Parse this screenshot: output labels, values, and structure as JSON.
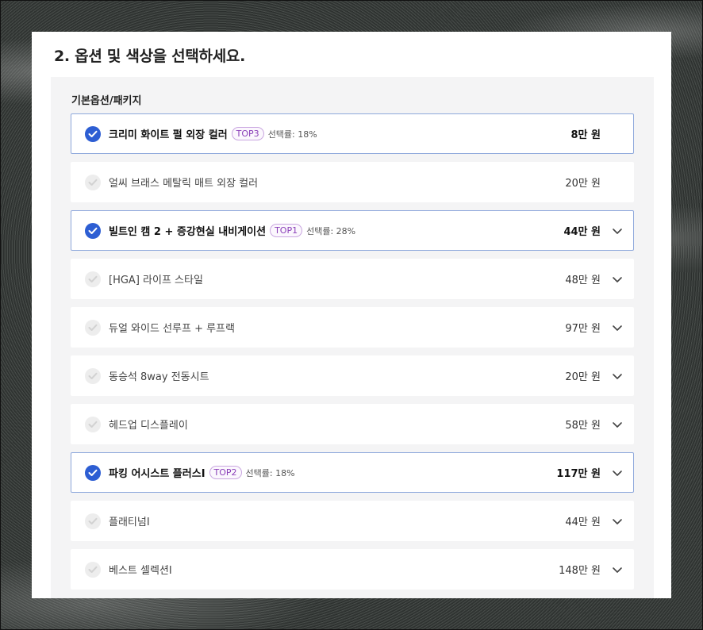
{
  "heading": "2. 옵션 및 색상을 선택하세요.",
  "panel_title": "기본옵션/패키지",
  "colors": {
    "accent": "#2d5ed3",
    "selected_border": "#8ea8dc",
    "badge": "#8a3fb8"
  },
  "options": [
    {
      "name": "크리미 화이트 펄 외장 컬러",
      "badge": "TOP3",
      "rate": "선택률: 18%",
      "price": "8만 원",
      "selected": true,
      "expandable": false
    },
    {
      "name": "얼씨 브래스 메탈릭 매트 외장 컬러",
      "badge": "",
      "rate": "",
      "price": "20만 원",
      "selected": false,
      "expandable": false
    },
    {
      "name": "빌트인 캠 2 + 증강현실 내비게이션",
      "badge": "TOP1",
      "rate": "선택률: 28%",
      "price": "44만 원",
      "selected": true,
      "expandable": true
    },
    {
      "name": "[HGA] 라이프 스타일",
      "badge": "",
      "rate": "",
      "price": "48만 원",
      "selected": false,
      "expandable": true
    },
    {
      "name": "듀얼 와이드 선루프 + 루프랙",
      "badge": "",
      "rate": "",
      "price": "97만 원",
      "selected": false,
      "expandable": true
    },
    {
      "name": "동승석 8way 전동시트",
      "badge": "",
      "rate": "",
      "price": "20만 원",
      "selected": false,
      "expandable": true
    },
    {
      "name": "헤드업 디스플레이",
      "badge": "",
      "rate": "",
      "price": "58만 원",
      "selected": false,
      "expandable": true
    },
    {
      "name": "파킹 어시스트 플러스I",
      "badge": "TOP2",
      "rate": "선택률: 18%",
      "price": "117만 원",
      "selected": true,
      "expandable": true
    },
    {
      "name": "플래티넘I",
      "badge": "",
      "rate": "",
      "price": "44만 원",
      "selected": false,
      "expandable": true
    },
    {
      "name": "베스트 셀렉션I",
      "badge": "",
      "rate": "",
      "price": "148만 원",
      "selected": false,
      "expandable": true
    }
  ]
}
